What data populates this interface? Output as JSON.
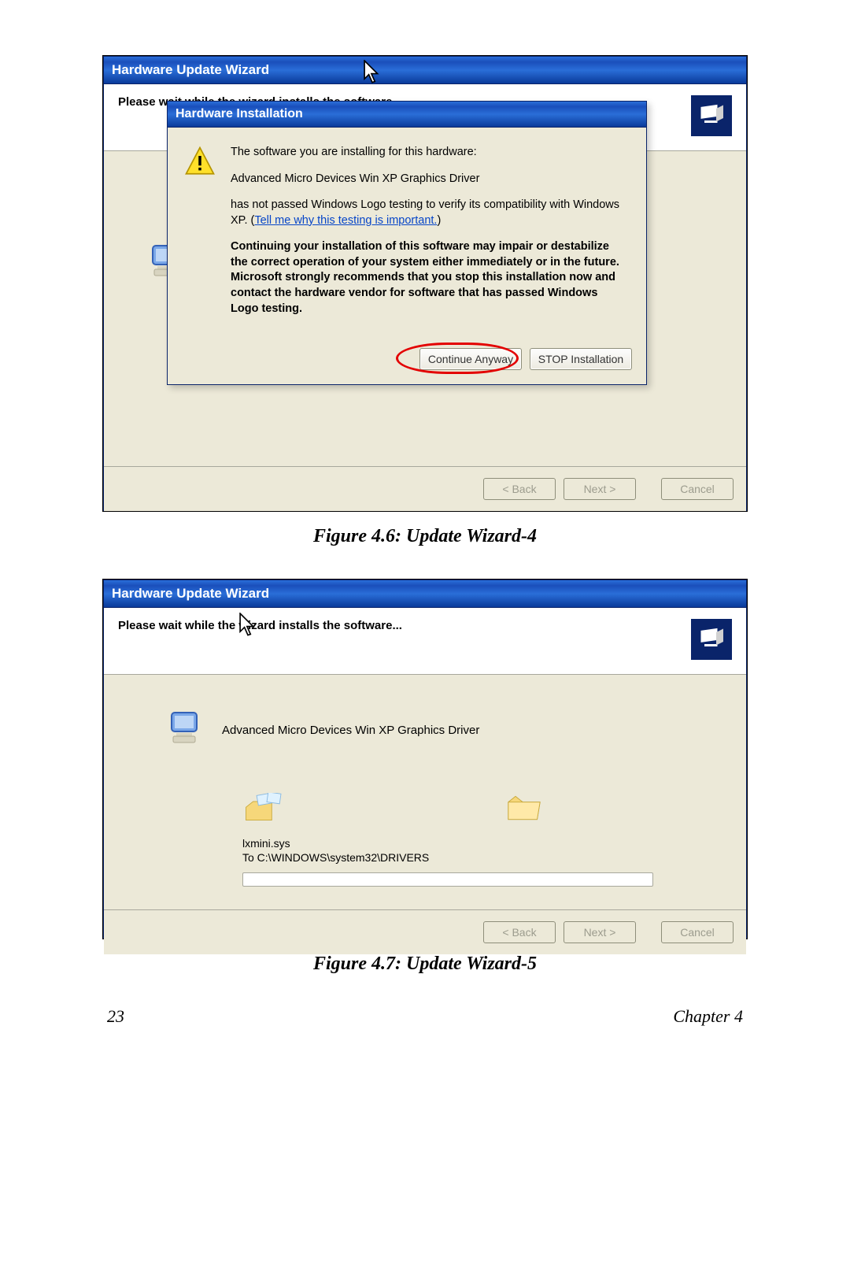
{
  "captions": {
    "fig1": "Figure 4.6: Update Wizard-4",
    "fig2": "Figure 4.7: Update Wizard-5"
  },
  "footer": {
    "page": "23",
    "chapter": "Chapter 4"
  },
  "wizard": {
    "title": "Hardware Update Wizard",
    "heading": "Please wait while the wizard installs the software...",
    "back": "< Back",
    "next": "Next >",
    "cancel": "Cancel"
  },
  "dlg_hw": {
    "title": "Hardware Installation",
    "p1": "The software you are installing for this hardware:",
    "p2": "Advanced Micro Devices Win XP Graphics Driver",
    "p3a": "has not passed Windows Logo testing to verify its compatibility with Windows XP. (",
    "link": "Tell me why this testing is important.",
    "p3b": ")",
    "p4": "Continuing your installation of this software may impair or destabilize the correct operation of your system either immediately or in the future. Microsoft strongly recommends that you stop this installation now and contact the hardware vendor for software that has passed Windows Logo testing.",
    "continue": "Continue Anyway",
    "stop": "STOP Installation"
  },
  "fig2_body": {
    "driver": "Advanced Micro Devices Win XP Graphics Driver",
    "file": "lxmini.sys",
    "dest": "To C:\\WINDOWS\\system32\\DRIVERS"
  }
}
